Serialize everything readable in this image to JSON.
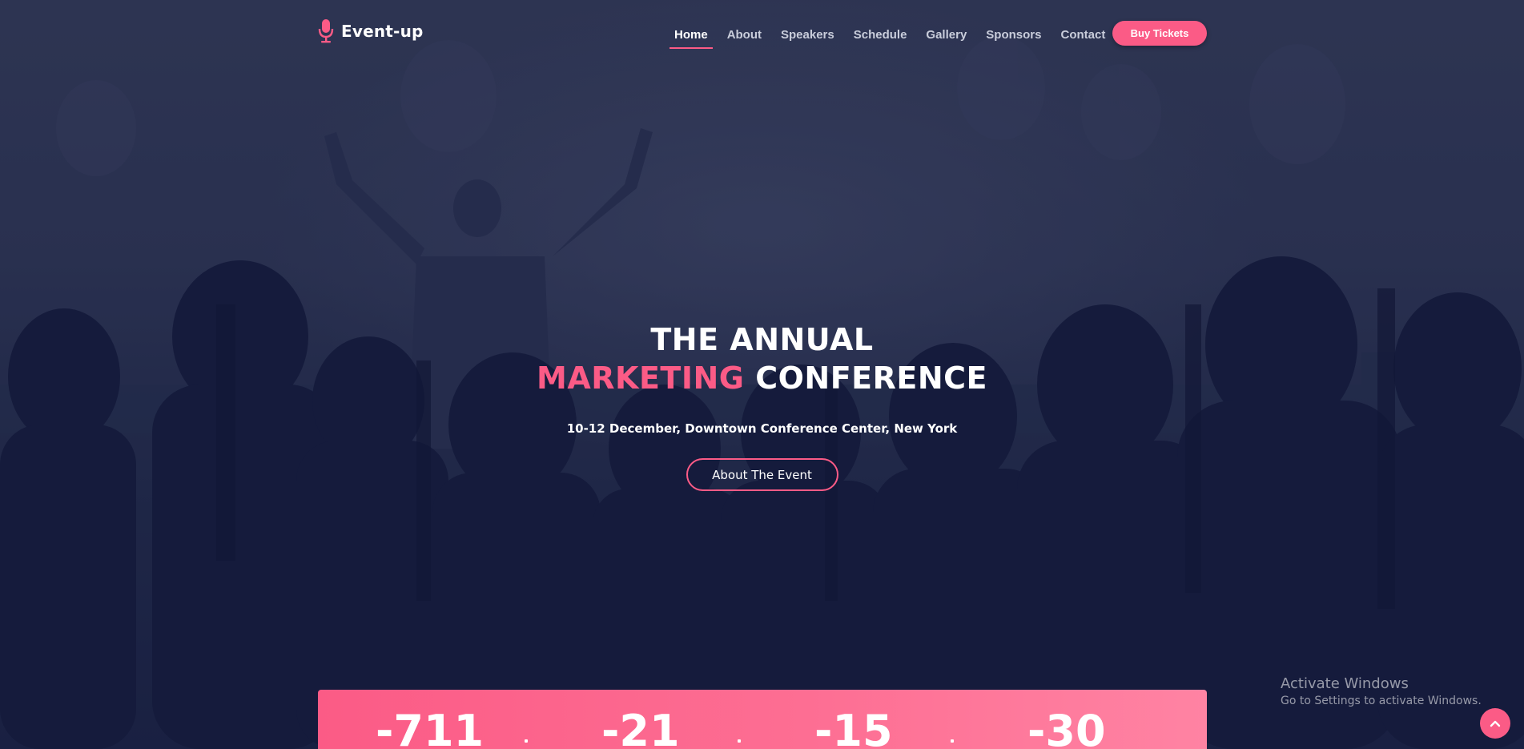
{
  "brand": {
    "name": "Event-up",
    "icon": "microphone-icon"
  },
  "nav": {
    "items": [
      "Home",
      "About",
      "Speakers",
      "Schedule",
      "Gallery",
      "Sponsors",
      "Contact"
    ],
    "active": "Home",
    "cta_label": "Buy Tickets"
  },
  "hero": {
    "title_line1": "THE ANNUAL",
    "title_accent": "MARKETING",
    "title_rest": "CONFERENCE",
    "subtitle": "10-12 December, Downtown Conference Center, New York",
    "button_label": "About The Event"
  },
  "countdown": {
    "values": [
      "-711",
      "-21",
      "-15",
      "-30"
    ]
  },
  "watermark": {
    "title": "Activate Windows",
    "subtitle": "Go to Settings to activate Windows."
  },
  "back_to_top": {
    "icon": "chevron-up-icon"
  },
  "colors": {
    "accent": "#fb5b86",
    "background": "#1f2746",
    "text": "#ffffff"
  }
}
